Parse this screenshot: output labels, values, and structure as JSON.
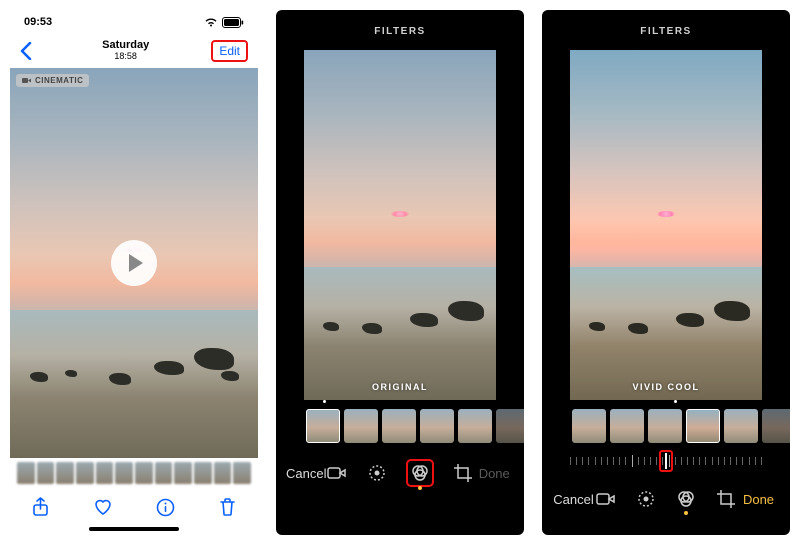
{
  "screen1": {
    "status_time": "09:53",
    "title": "Saturday",
    "subtitle": "18:58",
    "edit_label": "Edit",
    "badge": "CINEMATIC",
    "toolbar": {
      "share": "share-icon",
      "favorite": "heart-icon",
      "info": "info-icon",
      "trash": "trash-icon"
    }
  },
  "screen2": {
    "header": "FILTERS",
    "current_filter": "ORIGINAL",
    "selected_index": 0,
    "cancel": "Cancel",
    "done": "Done",
    "done_enabled": false
  },
  "screen3": {
    "header": "FILTERS",
    "current_filter": "VIVID COOL",
    "selected_index": 3,
    "slider_position": 0.5,
    "cancel": "Cancel",
    "done": "Done",
    "done_enabled": true
  },
  "colors": {
    "ios_blue": "#0a60ff",
    "highlight_red": "#e11",
    "done_yellow": "#f6c044"
  }
}
